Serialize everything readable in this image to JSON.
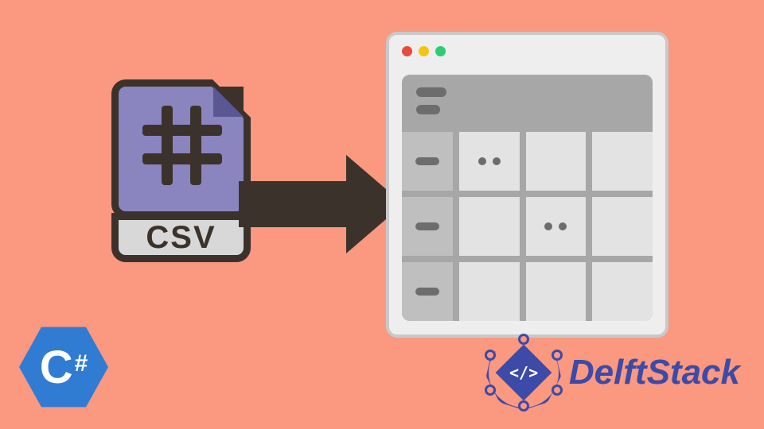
{
  "csv_icon": {
    "label": "CSV",
    "symbol": "hash"
  },
  "arrow": {
    "direction": "right"
  },
  "window": {
    "traffic_lights": [
      "red",
      "yellow",
      "green"
    ],
    "type": "spreadsheet",
    "rows": 3,
    "cols": 3
  },
  "csharp_logo": {
    "letter": "C",
    "sharp": "#"
  },
  "brand": {
    "name": "DelftStack",
    "badge_text": "</>"
  },
  "colors": {
    "background": "#fa9880",
    "csv_fill": "#8a85bf",
    "arrow": "#3b332b",
    "csharp": "#2f7cd2",
    "brand": "#3c4aa8"
  }
}
